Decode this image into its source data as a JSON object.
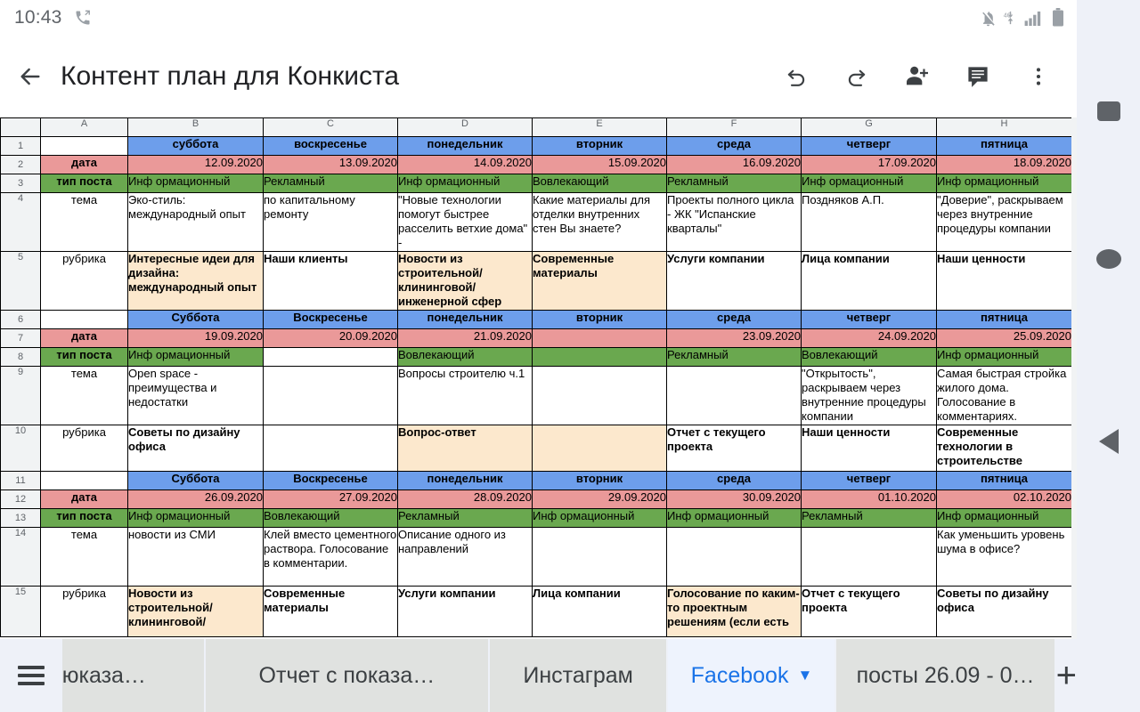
{
  "status_bar": {
    "time": "10:43",
    "left_icons": [
      "call-forward-icon"
    ],
    "right_icons": [
      "notifications-off-icon",
      "network-4g-icon",
      "signal-bars-icon",
      "battery-icon"
    ]
  },
  "app_bar": {
    "back_label": "←",
    "title": "Контент план для Конкиста",
    "actions": [
      {
        "name": "undo-button",
        "glyph": "↶"
      },
      {
        "name": "redo-button",
        "glyph": "↷"
      },
      {
        "name": "share-add-person-button",
        "glyph": "person-add-icon"
      },
      {
        "name": "comment-button",
        "glyph": "comment-icon"
      },
      {
        "name": "overflow-menu-button",
        "glyph": "⋮"
      }
    ]
  },
  "colors": {
    "weekday_header": "#6d9eeb",
    "date_row": "#ea9999",
    "post_type_row": "#6aa84f",
    "rubric_highlight": "#fce8cd",
    "accent": "#1a73e8",
    "tab_inactive": "#e0e2e0",
    "chrome": "#eef1f8"
  },
  "spreadsheet": {
    "column_headers": [
      "A",
      "B",
      "C",
      "D",
      "E",
      "F",
      "G",
      "H"
    ],
    "row_numbers": [
      "1",
      "2",
      "3",
      "4",
      "5",
      "6",
      "7",
      "8",
      "9",
      "10",
      "11",
      "12",
      "13",
      "14",
      "15"
    ],
    "labels": {
      "date": "дата",
      "post_type": "тип поста",
      "theme": "тема",
      "rubric": "рубрика"
    },
    "weeks": [
      {
        "days": [
          "суббота",
          "воскресенье",
          "понедельник",
          "вторник",
          "среда",
          "четверг",
          "пятница"
        ],
        "dates": [
          "12.09.2020",
          "13.09.2020",
          "14.09.2020",
          "15.09.2020",
          "16.09.2020",
          "17.09.2020",
          "18.09.2020"
        ],
        "types": [
          "Инф ормационный",
          "Рекламный",
          "Инф ормационный",
          "Вовлекающий",
          "Рекламный",
          "Инф ормационный",
          "Инф ормационный"
        ],
        "themes": [
          "Эко-стиль: международный опыт",
          "по капитальному ремонту",
          "\"Новые технологии помогут быстрее расселить ветхие дома\" -",
          "Какие материалы для отделки внутренних стен Вы знаете?",
          "Проекты полного цикла - ЖК \"Испанские кварталы\"",
          "Поздняков А.П.",
          "\"Доверие\", раскрываем через внутренние процедуры компании"
        ],
        "rubrics": [
          "Интересные идеи для дизайна: международный опыт",
          "Наши клиенты",
          "Новости из строительной/ клининговой/ инженерной сфер",
          "Современные материалы",
          "Услуги компании",
          "Лица компании",
          "Наши ценности"
        ],
        "rubric_fill": [
          true,
          false,
          true,
          true,
          false,
          false,
          false
        ]
      },
      {
        "days": [
          "Суббота",
          "Воскресенье",
          "понедельник",
          "вторник",
          "среда",
          "четверг",
          "пятница"
        ],
        "dates": [
          "19.09.2020",
          "20.09.2020",
          "21.09.2020",
          "",
          "23.09.2020",
          "24.09.2020",
          "25.09.2020"
        ],
        "types": [
          "Инф ормационный",
          "",
          "Вовлекающий",
          "",
          "Рекламный",
          "Вовлекающий",
          "Инф ормационный"
        ],
        "type_fill": [
          true,
          false,
          true,
          true,
          true,
          true,
          true
        ],
        "themes": [
          "Open space - преимущества и недостатки",
          "",
          "Вопросы строителю ч.1",
          "",
          "",
          "\"Открытость\", раскрываем через внутренние процедуры компании",
          "Самая быстрая стройка жилого дома. Голосование в комментариях."
        ],
        "rubrics": [
          "Советы по дизайну офиса",
          "",
          "Вопрос-ответ",
          "",
          "Отчет с текущего проекта",
          "Наши ценности",
          "Современные технологии в строительстве"
        ],
        "rubric_fill": [
          false,
          false,
          true,
          true,
          false,
          false,
          false
        ]
      },
      {
        "days": [
          "Суббота",
          "Воскресенье",
          "понедельник",
          "вторник",
          "среда",
          "четверг",
          "пятница"
        ],
        "dates": [
          "26.09.2020",
          "27.09.2020",
          "28.09.2020",
          "29.09.2020",
          "30.09.2020",
          "01.10.2020",
          "02.10.2020"
        ],
        "types": [
          "Инф ормационный",
          "Вовлекающий",
          "Рекламный",
          "Инф ормационный",
          "Инф ормационный",
          "Рекламный",
          "Инф ормационный"
        ],
        "themes": [
          "новости из СМИ",
          "Клей вместо цементного раствора. Голосование в комментарии.",
          "Описание одного из направлений",
          "",
          "",
          "",
          "Как уменьшить уровень шума в офисе?"
        ],
        "rubrics": [
          "Новости из строительной/ клининговой/",
          "Современные материалы",
          "Услуги компании",
          "Лица компании",
          "Голосование по каким-то проектным решениям (если есть",
          "Отчет с текущего проекта",
          "Советы по дизайну офиса"
        ],
        "rubric_fill": [
          true,
          false,
          false,
          false,
          true,
          false,
          false
        ]
      }
    ]
  },
  "sheet_tabs": {
    "items": [
      {
        "label": "юказа…",
        "active": false,
        "clipped": true
      },
      {
        "label": "Отчет с показа…",
        "active": false,
        "clipped": false
      },
      {
        "label": "Инстаграм",
        "active": false,
        "clipped": false
      },
      {
        "label": "Facebook",
        "active": true,
        "clipped": false
      },
      {
        "label": "посты 26.09 - 0…",
        "active": false,
        "clipped": false
      }
    ],
    "active_caret": "▼",
    "add_label": "+",
    "menu_name": "all-sheets-menu"
  },
  "nav_rail": {
    "recents": "recents-button",
    "home": "home-button",
    "back": "back-button"
  }
}
